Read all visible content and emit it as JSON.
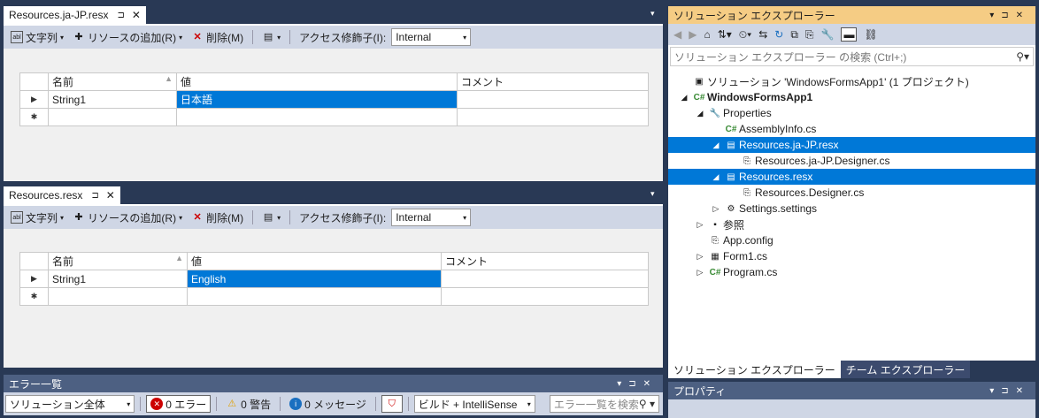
{
  "doc1": {
    "tab": "Resources.ja-JP.resx",
    "pin": "⊐",
    "close": "✕"
  },
  "doc2": {
    "tab": "Resources.resx",
    "pin": "⊐",
    "close": "✕"
  },
  "toolbar": {
    "strings": "文字列",
    "add": "リソースの追加(R)",
    "delete": "削除(M)",
    "access": "アクセス修飾子(I):",
    "access_value": "Internal"
  },
  "grid_headers": [
    "名前",
    "値",
    "コメント"
  ],
  "grid1": {
    "name": "String1",
    "value": "日本語",
    "comment": ""
  },
  "grid2": {
    "name": "String1",
    "value": "English",
    "comment": ""
  },
  "errorlist": {
    "title": "エラー一覧",
    "scope": "ソリューション全体",
    "errors": "0 エラー",
    "warnings": "0 警告",
    "messages": "0 メッセージ",
    "build": "ビルド + IntelliSense",
    "search_placeholder": "エラー一覧を検索"
  },
  "se": {
    "title": "ソリューション エクスプローラー",
    "search": "ソリューション エクスプローラー の検索 (Ctrl+;)",
    "items": [
      {
        "label": "ソリューション 'WindowsFormsApp1' (1 プロジェクト)",
        "indent": 0,
        "arrow": "",
        "icon": "▣"
      },
      {
        "label": "WindowsFormsApp1",
        "indent": 0,
        "arrow": "◢",
        "icon": "C#",
        "bold": true
      },
      {
        "label": "Properties",
        "indent": 1,
        "arrow": "◢",
        "icon": "🔧"
      },
      {
        "label": "AssemblyInfo.cs",
        "indent": 2,
        "arrow": "",
        "icon": "C#"
      },
      {
        "label": "Resources.ja-JP.resx",
        "indent": 2,
        "arrow": "◢",
        "icon": "▤",
        "hl": true
      },
      {
        "label": "Resources.ja-JP.Designer.cs",
        "indent": 3,
        "arrow": "",
        "icon": "⎘"
      },
      {
        "label": "Resources.resx",
        "indent": 2,
        "arrow": "◢",
        "icon": "▤",
        "hl": true
      },
      {
        "label": "Resources.Designer.cs",
        "indent": 3,
        "arrow": "",
        "icon": "⎘"
      },
      {
        "label": "Settings.settings",
        "indent": 2,
        "arrow": "▷",
        "icon": "⚙"
      },
      {
        "label": "参照",
        "indent": 1,
        "arrow": "▷",
        "icon": "▪"
      },
      {
        "label": "App.config",
        "indent": 1,
        "arrow": "",
        "icon": "⎘"
      },
      {
        "label": "Form1.cs",
        "indent": 1,
        "arrow": "▷",
        "icon": "▦"
      },
      {
        "label": "Program.cs",
        "indent": 1,
        "arrow": "▷",
        "icon": "C#"
      }
    ],
    "tab1": "ソリューション エクスプローラー",
    "tab2": "チーム エクスプローラー"
  },
  "props": {
    "title": "プロパティ"
  },
  "colors": {
    "accent": "#0078d7",
    "frame": "#293955",
    "title_active": "#f5cc84"
  }
}
